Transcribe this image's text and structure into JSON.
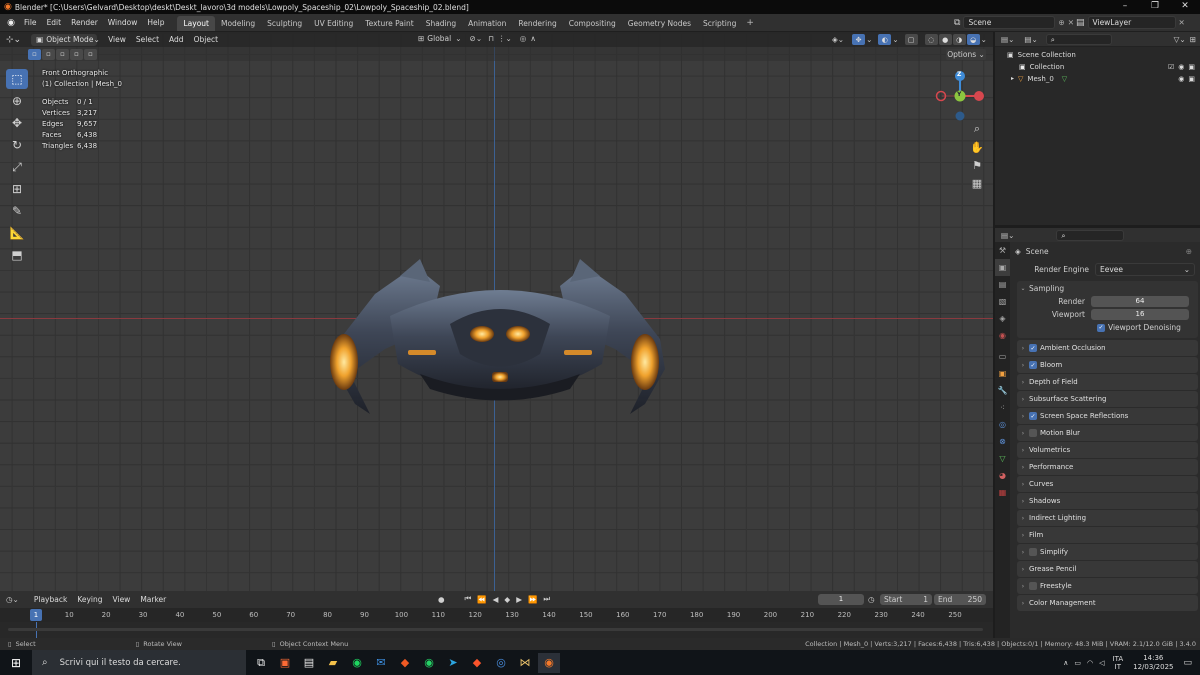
{
  "window": {
    "title": "Blender* [C:\\Users\\Gelvard\\Desktop\\deskt\\Deskt_lavoro\\3d models\\Lowpoly_Spaceship_02\\Lowpoly_Spaceship_02.blend]",
    "minimize": "–",
    "maximize": "❐",
    "close": "✕"
  },
  "menu": [
    "File",
    "Edit",
    "Render",
    "Window",
    "Help"
  ],
  "workspaces": [
    {
      "label": "Layout",
      "active": true
    },
    {
      "label": "Modeling"
    },
    {
      "label": "Sculpting"
    },
    {
      "label": "UV Editing"
    },
    {
      "label": "Texture Paint"
    },
    {
      "label": "Shading"
    },
    {
      "label": "Animation"
    },
    {
      "label": "Rendering"
    },
    {
      "label": "Compositing"
    },
    {
      "label": "Geometry Nodes"
    },
    {
      "label": "Scripting"
    }
  ],
  "add_workspace": "+",
  "scene": {
    "name": "Scene",
    "view_layer": "ViewLayer"
  },
  "viewport": {
    "mode": "Object Mode",
    "menus": [
      "View",
      "Select",
      "Add",
      "Object"
    ],
    "orientation": "Global",
    "options": "Options ⌄",
    "view_name": "Front Orthographic",
    "collection_info": "(1) Collection | Mesh_0",
    "stats": [
      {
        "label": "Objects",
        "value": "0 / 1"
      },
      {
        "label": "Vertices",
        "value": "3,217"
      },
      {
        "label": "Edges",
        "value": "9,657"
      },
      {
        "label": "Faces",
        "value": "6,438"
      },
      {
        "label": "Triangles",
        "value": "6,438"
      }
    ],
    "gizmo": {
      "z": "Z",
      "y": "Y"
    }
  },
  "outliner": {
    "search_placeholder": "",
    "root": "Scene Collection",
    "items": [
      {
        "label": "Collection"
      },
      {
        "label": "Mesh_0"
      }
    ]
  },
  "properties": {
    "scene_label": "Scene",
    "render_engine_label": "Render Engine",
    "render_engine": "Eevee",
    "sampling": {
      "label": "Sampling",
      "render_label": "Render",
      "render": "64",
      "viewport_label": "Viewport",
      "viewport": "16",
      "denoise_label": "Viewport Denoising"
    },
    "panels": [
      {
        "label": "Ambient Occlusion",
        "check": "on"
      },
      {
        "label": "Bloom",
        "check": "on"
      },
      {
        "label": "Depth of Field",
        "check": "none"
      },
      {
        "label": "Subsurface Scattering",
        "check": "none"
      },
      {
        "label": "Screen Space Reflections",
        "check": "on"
      },
      {
        "label": "Motion Blur",
        "check": "off"
      },
      {
        "label": "Volumetrics",
        "check": "none"
      },
      {
        "label": "Performance",
        "check": "none"
      },
      {
        "label": "Curves",
        "check": "none"
      },
      {
        "label": "Shadows",
        "check": "none"
      },
      {
        "label": "Indirect Lighting",
        "check": "none"
      },
      {
        "label": "Film",
        "check": "none"
      },
      {
        "label": "Simplify",
        "check": "off"
      },
      {
        "label": "Grease Pencil",
        "check": "none"
      },
      {
        "label": "Freestyle",
        "check": "off"
      },
      {
        "label": "Color Management",
        "check": "none"
      }
    ]
  },
  "timeline": {
    "menus": [
      "Playback",
      "Keying",
      "View",
      "Marker"
    ],
    "current_frame": "1",
    "start_label": "Start",
    "start": "1",
    "end_label": "End",
    "end": "250",
    "ticks": [
      "1",
      "10",
      "20",
      "30",
      "40",
      "50",
      "60",
      "70",
      "80",
      "90",
      "100",
      "110",
      "120",
      "130",
      "140",
      "150",
      "160",
      "170",
      "180",
      "190",
      "200",
      "210",
      "220",
      "230",
      "240",
      "250"
    ]
  },
  "statusbar": {
    "select": "Select",
    "rotate": "Rotate View",
    "context": "Object Context Menu",
    "info": "Collection | Mesh_0 | Verts:3,217 | Faces:6,438 | Tris:6,438 | Objects:0/1 | Memory: 48.3 MiB | VRAM: 2.1/12.0 GiB | 3.4.0"
  },
  "taskbar": {
    "search_placeholder": "Scrivi qui il testo da cercare.",
    "lang": "ITA",
    "lang2": "IT",
    "time": "14:36",
    "date": "12/03/2025"
  }
}
